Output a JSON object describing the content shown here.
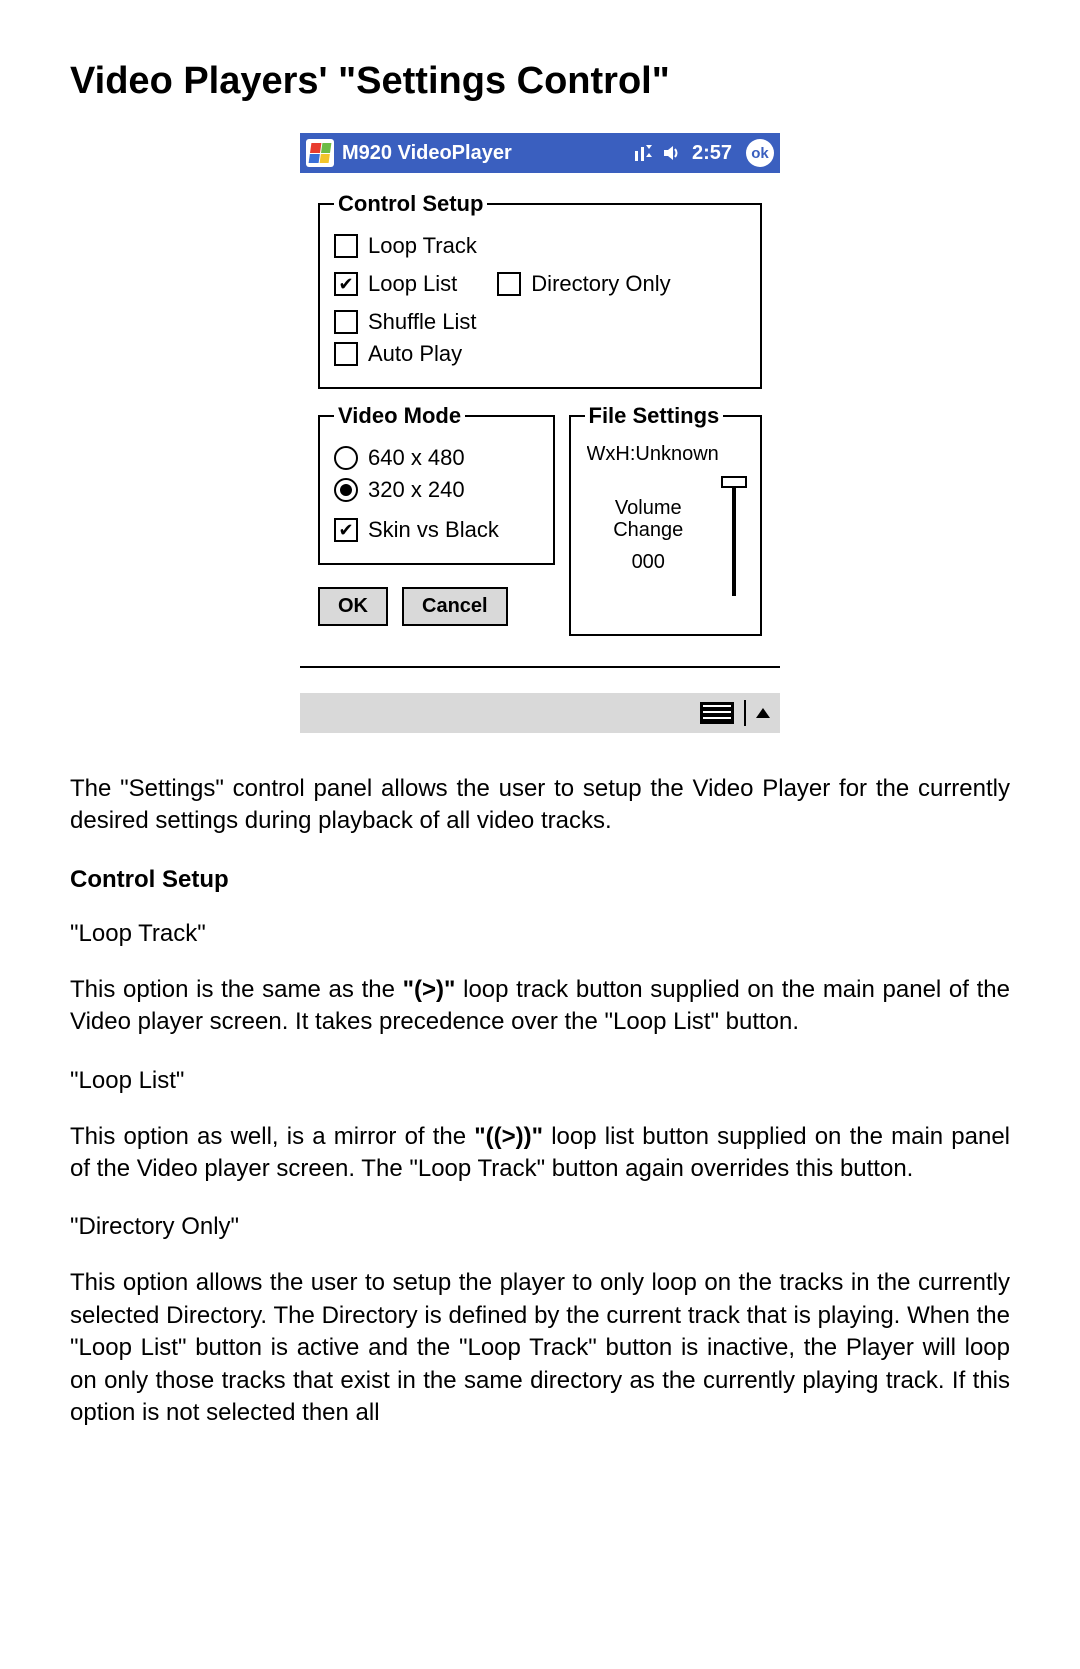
{
  "doc": {
    "title": "Video Players' \"Settings Control\"",
    "intro": "The \"Settings\" control panel allows the user to setup the Video Player for the currently desired settings during playback of all video tracks.",
    "section_control_setup": "Control Setup",
    "items": {
      "loop_track": {
        "name": "\"Loop Track\"",
        "desc_a": "This option is the same as the ",
        "bold": "\"(>)\"",
        "desc_b": " loop track button supplied on the main panel of the Video player screen.  It takes precedence over the \"Loop List\" button."
      },
      "loop_list": {
        "name": "\"Loop List\"",
        "desc_a": "This option as well, is a mirror of the ",
        "bold": "\"((>))\"",
        "desc_b": " loop list button supplied on the main panel of the Video player screen.  The \"Loop Track\" button again overrides this button."
      },
      "dir_only": {
        "name": "\"Directory Only\"",
        "desc": "This option allows the user to setup the player to only loop on the tracks in the currently selected Directory.  The Directory is defined by the current track that is playing.  When the \"Loop List\" button is active and the \"Loop Track\" button is inactive, the Player will loop on only those tracks that exist in the same directory as the currently playing track.  If this option is not selected then all"
      }
    }
  },
  "ui": {
    "titlebar": {
      "app": "M920 VideoPlayer",
      "time": "2:57",
      "ok": "ok"
    },
    "groups": {
      "control_setup": {
        "legend": "Control Setup",
        "loop_track": "Loop Track",
        "loop_list": "Loop List",
        "directory_only": "Directory Only",
        "shuffle_list": "Shuffle List",
        "auto_play": "Auto Play"
      },
      "video_mode": {
        "legend": "Video Mode",
        "r640": "640 x 480",
        "r320": "320 x 240",
        "skin": "Skin vs Black"
      },
      "file_settings": {
        "legend": "File Settings",
        "wxh": "WxH:Unknown",
        "vol_label_1": "Volume",
        "vol_label_2": "Change",
        "vol_value": "000"
      }
    },
    "buttons": {
      "ok": "OK",
      "cancel": "Cancel"
    }
  }
}
